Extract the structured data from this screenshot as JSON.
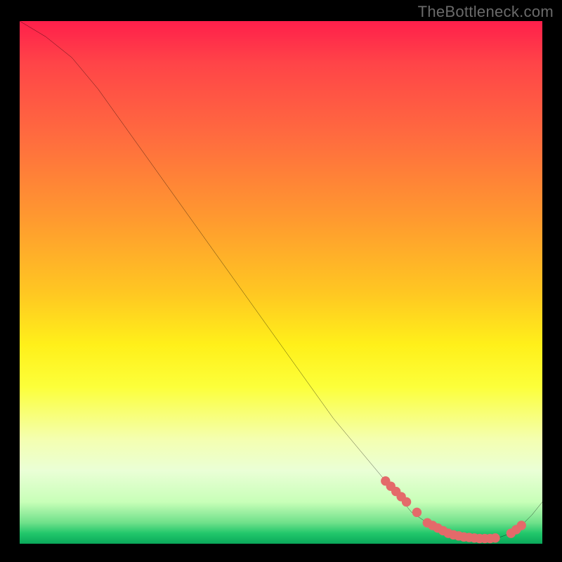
{
  "attribution": "TheBottleneck.com",
  "chart_data": {
    "type": "line",
    "title": "",
    "xlabel": "",
    "ylabel": "",
    "xlim": [
      0,
      100
    ],
    "ylim": [
      0,
      100
    ],
    "series": [
      {
        "name": "bottleneck-curve",
        "x": [
          0,
          5,
          10,
          15,
          20,
          25,
          30,
          35,
          40,
          45,
          50,
          55,
          60,
          65,
          70,
          75,
          78,
          80,
          82,
          84,
          86,
          88,
          90,
          92,
          94,
          96,
          98,
          100
        ],
        "y": [
          100,
          97,
          93,
          87,
          80,
          73,
          66,
          59,
          52,
          45,
          38,
          31,
          24,
          18,
          12,
          6,
          4,
          3,
          2,
          1.5,
          1.2,
          1,
          1,
          1.3,
          2,
          3.5,
          5.5,
          8
        ]
      }
    ],
    "markers": {
      "name": "highlight-dots",
      "color": "#e46a6a",
      "x": [
        70,
        71,
        72,
        73,
        74,
        76,
        78,
        79,
        80,
        81,
        82,
        83,
        84,
        85,
        86,
        87,
        88,
        89,
        90,
        91,
        94,
        95,
        96
      ],
      "y": [
        12,
        11,
        10,
        9,
        8,
        6,
        4,
        3.5,
        3,
        2.5,
        2,
        1.7,
        1.5,
        1.3,
        1.2,
        1.1,
        1,
        1,
        1,
        1.1,
        2,
        2.7,
        3.5
      ]
    }
  }
}
